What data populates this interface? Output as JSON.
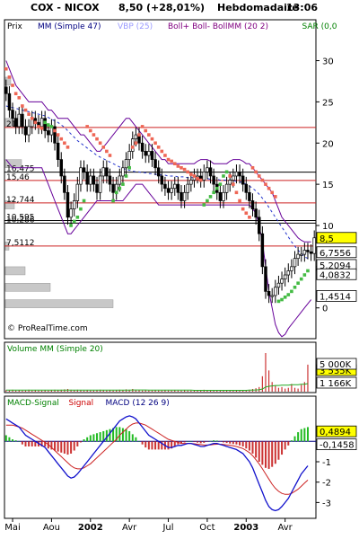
{
  "header": {
    "symbol": "COX - NICOX",
    "quote": "8,50 (+28,01%)",
    "period": "Hebdomadaire",
    "time": "13:06"
  },
  "legend_main": [
    {
      "text": "Prix",
      "color": "#000000"
    },
    {
      "text": "MM (Simple 47)",
      "color": "#000080"
    },
    {
      "text": "VBP (25)",
      "color": "#9a9aff"
    },
    {
      "text": "Boll+ Boll- BollMM (20 2)",
      "color": "#800080"
    },
    {
      "text": "SAR (0,0",
      "color": "#008000"
    }
  ],
  "legend_volume": {
    "text": "Volume MM (Simple 20)",
    "color": "#008000"
  },
  "legend_macd": [
    {
      "text": "MACD-Signal",
      "color": "#008000"
    },
    {
      "text": "Signal",
      "color": "#cc0000"
    },
    {
      "text": "MACD (12 26 9)",
      "color": "#000080"
    }
  ],
  "watermark": "© ProRealTime.com",
  "colors": {
    "frame": "#000000",
    "bg": "#ffffff",
    "candle_up": "#ffffff",
    "candle_down": "#000000",
    "sar_up": "#44bb44",
    "sar_down": "#ee6655",
    "boll": "#660099",
    "mm": "#2233cc",
    "hline_red": "#cc2222",
    "hline_black": "#000000",
    "vbp": "#c8c8c8",
    "volume": "#cc3333",
    "volume_ma": "#22aa22",
    "macd": "#1111cc",
    "signal": "#cc2222",
    "hist": "#22bb22",
    "hist_neg": "#cc3333",
    "tag_yellow": "#ffff00"
  },
  "chart_data": [
    {
      "type": "candlestick",
      "panel": "price",
      "x_labels": [
        "Mai",
        "Aou",
        "2002",
        "Avr",
        "Jul",
        "Oct",
        "2003",
        "Avr"
      ],
      "y_ticks": [
        0,
        5,
        10,
        15,
        20,
        25,
        30
      ],
      "ylim": [
        -3.3,
        33
      ],
      "right_tags": [
        {
          "text": "8,5",
          "value": 8.5,
          "style": "yellow"
        },
        {
          "text": "6,7556",
          "value": 6.7556,
          "style": "box"
        },
        {
          "text": "5,2094",
          "value": 5.2094,
          "style": "box"
        },
        {
          "text": "4,0832",
          "value": 4.0832,
          "style": "box"
        },
        {
          "text": "1,4514",
          "value": 1.4514,
          "style": "box"
        }
      ],
      "horizontal_levels": [
        {
          "text": "21,9",
          "value": 21.9,
          "color": "red"
        },
        {
          "text": "16,475",
          "value": 16.475,
          "color": "black"
        },
        {
          "text": "15,46",
          "value": 15.46,
          "color": "red"
        },
        {
          "text": "12,744",
          "value": 12.744,
          "color": "red"
        },
        {
          "text": "10,595",
          "value": 10.595,
          "color": "black"
        },
        {
          "text": "10,286",
          "value": 10.286,
          "color": "black"
        },
        {
          "text": "7,5112",
          "value": 7.5112,
          "color": "red"
        }
      ],
      "close": [
        26,
        24,
        23,
        22,
        23.5,
        22,
        21,
        22,
        23,
        22.5,
        22,
        23,
        21.5,
        21,
        22,
        20,
        18,
        16,
        14,
        11,
        12,
        13,
        15,
        17,
        16.5,
        15,
        16,
        15,
        14,
        16,
        17,
        16,
        15,
        14,
        15,
        16,
        17,
        18,
        19,
        20.5,
        21,
        20,
        19,
        18.5,
        19,
        18,
        17,
        16,
        15,
        14.5,
        14,
        14.5,
        15,
        14,
        13,
        14,
        15,
        15.5,
        16,
        16,
        15.5,
        16.5,
        17,
        16,
        15,
        14,
        13,
        14,
        15,
        15.5,
        16,
        16.5,
        16,
        15,
        14,
        13,
        12,
        11,
        9,
        5,
        2,
        1.5,
        1.5,
        2.5,
        3,
        3.5,
        4,
        4.5,
        5,
        6,
        6.5,
        6.5,
        7,
        6.8,
        6.6,
        8.5
      ],
      "sar": [
        29,
        28,
        27,
        26,
        25.5,
        24.5,
        24,
        23.5,
        23,
        22.5,
        22,
        21.8,
        22.5,
        22.2,
        22,
        21.5,
        21,
        20.5,
        20,
        19.5,
        10,
        10.5,
        11,
        12,
        13,
        22,
        21.5,
        21,
        20.5,
        20,
        19.5,
        19,
        18.5,
        13,
        14,
        14.5,
        15,
        16,
        17,
        19.5,
        20,
        21,
        22,
        21.5,
        21,
        20.5,
        20,
        19.5,
        19,
        18.5,
        18,
        17.8,
        17.5,
        17.2,
        17,
        16.8,
        16.5,
        16.2,
        16,
        15.7,
        15.5,
        12.5,
        13,
        13.5,
        14,
        14.5,
        15,
        16,
        16.5,
        16,
        15,
        14,
        13,
        12,
        11.5,
        11,
        17,
        16.5,
        16,
        15.5,
        15,
        14.5,
        14,
        13.5,
        0.8,
        1,
        1.3,
        1.6,
        2,
        2.5,
        3,
        3.5,
        4,
        4.5
      ],
      "sar_trend": [
        -1,
        -1,
        -1,
        -1,
        -1,
        -1,
        -1,
        -1,
        -1,
        -1,
        -1,
        -1,
        1,
        1,
        1,
        -1,
        -1,
        -1,
        -1,
        -1,
        1,
        1,
        1,
        1,
        1,
        -1,
        -1,
        -1,
        -1,
        -1,
        -1,
        -1,
        -1,
        1,
        1,
        1,
        1,
        1,
        1,
        -1,
        -1,
        -1,
        -1,
        -1,
        -1,
        -1,
        -1,
        -1,
        -1,
        -1,
        -1,
        -1,
        -1,
        -1,
        -1,
        -1,
        -1,
        -1,
        -1,
        -1,
        -1,
        1,
        1,
        1,
        1,
        1,
        1,
        1,
        1,
        -1,
        -1,
        -1,
        -1,
        -1,
        -1,
        -1,
        -1,
        -1,
        -1,
        -1,
        -1,
        -1,
        -1,
        -1,
        1,
        1,
        1,
        1,
        1,
        1,
        1,
        1,
        1,
        1
      ],
      "boll_upper": [
        30,
        29,
        28,
        27,
        26.5,
        26,
        25.5,
        25,
        25,
        25,
        25,
        25,
        24.5,
        24,
        24,
        23.5,
        23,
        23,
        23,
        23,
        22.5,
        22,
        21.5,
        21,
        21,
        20.5,
        20,
        19.5,
        19,
        19,
        19.5,
        20,
        20.5,
        21,
        21.5,
        22,
        22.5,
        23,
        23,
        22.5,
        22,
        21.5,
        21,
        20.5,
        20,
        19.5,
        19,
        18.5,
        18,
        18,
        17.5,
        17.5,
        17.5,
        17.5,
        17.5,
        17.5,
        17.5,
        17.5,
        17.5,
        17.8,
        18,
        18,
        18,
        17.8,
        17.5,
        17.5,
        17.5,
        17.5,
        17.5,
        17.8,
        18,
        18,
        18,
        17.8,
        17.5,
        17.5,
        17,
        16.5,
        16,
        15.5,
        15,
        14.5,
        14,
        13,
        12,
        11,
        10.5,
        10,
        9.5,
        9,
        8.5,
        8.2,
        8,
        8,
        8
      ],
      "boll_lower": [
        18,
        17.5,
        17,
        17,
        17,
        17,
        17,
        17,
        17,
        17,
        17,
        17,
        16,
        15,
        14,
        13,
        12,
        11,
        10,
        9,
        9,
        9.5,
        10,
        10.5,
        11,
        11.5,
        12,
        12.5,
        13,
        13,
        13,
        13,
        13,
        13,
        13,
        13,
        13,
        13.5,
        14,
        14.5,
        15,
        15,
        15,
        14.5,
        14,
        13.5,
        13,
        12.5,
        12.5,
        12.5,
        12.5,
        12.5,
        12.5,
        12.5,
        12.5,
        12.5,
        12.5,
        12.5,
        12.5,
        12.5,
        12.5,
        12.5,
        12.5,
        12.5,
        12.5,
        12.5,
        12.5,
        12.5,
        12.5,
        12.5,
        12.5,
        12.5,
        12.5,
        12.5,
        12.5,
        12.5,
        12,
        11.5,
        10,
        8,
        5,
        2,
        0,
        -2,
        -3,
        -3.5,
        -3.2,
        -2.5,
        -2,
        -1.5,
        -1,
        -0.5,
        0,
        0.5,
        1
      ],
      "mm47": [
        24.5,
        24.4,
        24.3,
        24.2,
        24.1,
        24,
        23.9,
        23.8,
        23.7,
        23.6,
        23.5,
        23.4,
        23.3,
        23.1,
        22.9,
        22.7,
        22.5,
        22.2,
        21.9,
        21.5,
        21.1,
        20.7,
        20.3,
        20,
        19.7,
        19.4,
        19.1,
        18.8,
        18.5,
        18.3,
        18.1,
        17.9,
        17.7,
        17.5,
        17.3,
        17.1,
        16.9,
        16.8,
        16.7,
        16.6,
        16.5,
        16.5,
        16.4,
        16.4,
        16.3,
        16.3,
        16.2,
        16.2,
        16.1,
        16.1,
        16,
        16,
        16,
        15.9,
        15.9,
        15.9,
        15.8,
        15.8,
        15.8,
        15.8,
        15.7,
        15.7,
        15.7,
        15.6,
        15.6,
        15.6,
        15.5,
        15.5,
        15.5,
        15.5,
        15.4,
        15.4,
        15.3,
        15.2,
        15,
        14.8,
        14.5,
        14.2,
        13.8,
        13.3,
        12.8,
        12.2,
        11.6,
        11,
        10.4,
        9.8,
        9.2,
        8.6,
        8,
        7.5,
        7,
        6.6,
        6.2,
        6
      ],
      "vbp_bins": [
        {
          "price": 27.5,
          "size": 6
        },
        {
          "price": 22.5,
          "size": 20
        },
        {
          "price": 17.5,
          "size": 18
        },
        {
          "price": 12.5,
          "size": 10
        },
        {
          "price": 7.5,
          "size": 4
        },
        {
          "price": 4.5,
          "size": 22
        },
        {
          "price": 2.5,
          "size": 50
        },
        {
          "price": 0.5,
          "size": 120
        }
      ]
    },
    {
      "type": "bar",
      "panel": "volume",
      "right_tags": [
        {
          "text": "3 535K",
          "style": "yellow"
        },
        {
          "text": "5 000K",
          "style": "box"
        },
        {
          "text": "1 166K",
          "style": "box"
        }
      ],
      "values": [
        0.04,
        0.03,
        0.05,
        0.03,
        0.04,
        0.03,
        0.03,
        0.05,
        0.03,
        0.04,
        0.03,
        0.03,
        0.04,
        0.03,
        0.04,
        0.05,
        0.04,
        0.05,
        0.06,
        0.07,
        0.05,
        0.04,
        0.05,
        0.04,
        0.03,
        0.04,
        0.03,
        0.03,
        0.04,
        0.05,
        0.04,
        0.03,
        0.04,
        0.03,
        0.04,
        0.05,
        0.04,
        0.06,
        0.05,
        0.07,
        0.05,
        0.04,
        0.03,
        0.04,
        0.03,
        0.03,
        0.04,
        0.03,
        0.03,
        0.04,
        0.03,
        0.03,
        0.04,
        0.03,
        0.03,
        0.04,
        0.03,
        0.03,
        0.04,
        0.03,
        0.04,
        0.05,
        0.04,
        0.03,
        0.03,
        0.04,
        0.03,
        0.03,
        0.04,
        0.03,
        0.04,
        0.03,
        0.03,
        0.04,
        0.03,
        0.05,
        0.07,
        0.09,
        0.12,
        0.4,
        1.0,
        0.55,
        0.25,
        0.15,
        0.1,
        0.12,
        0.08,
        0.1,
        0.2,
        0.1,
        0.08,
        0.18,
        0.25,
        0.7
      ],
      "ma20": [
        0.04,
        0.04,
        0.04,
        0.04,
        0.04,
        0.04,
        0.04,
        0.04,
        0.04,
        0.04,
        0.04,
        0.04,
        0.04,
        0.04,
        0.04,
        0.04,
        0.04,
        0.04,
        0.04,
        0.04,
        0.04,
        0.04,
        0.04,
        0.04,
        0.04,
        0.04,
        0.04,
        0.04,
        0.04,
        0.04,
        0.04,
        0.04,
        0.04,
        0.04,
        0.04,
        0.04,
        0.04,
        0.04,
        0.04,
        0.045,
        0.045,
        0.045,
        0.045,
        0.045,
        0.04,
        0.04,
        0.04,
        0.04,
        0.04,
        0.04,
        0.04,
        0.04,
        0.04,
        0.04,
        0.04,
        0.04,
        0.04,
        0.04,
        0.035,
        0.035,
        0.035,
        0.035,
        0.035,
        0.035,
        0.035,
        0.035,
        0.035,
        0.035,
        0.035,
        0.035,
        0.035,
        0.035,
        0.035,
        0.035,
        0.035,
        0.04,
        0.04,
        0.045,
        0.05,
        0.07,
        0.12,
        0.14,
        0.15,
        0.16,
        0.16,
        0.17,
        0.17,
        0.17,
        0.18,
        0.18,
        0.18,
        0.19,
        0.19,
        0.21
      ]
    },
    {
      "type": "line",
      "panel": "macd",
      "y_ticks": [
        -3,
        -2,
        -1
      ],
      "ylim": [
        -3.6,
        1.6
      ],
      "right_tags": [
        {
          "text": "0,4894",
          "value": 0.4894,
          "style": "yellow"
        },
        {
          "text": "-0,1458",
          "value": -0.1458,
          "style": "box"
        }
      ],
      "macd": [
        1.1,
        1.0,
        0.9,
        0.8,
        0.7,
        0.5,
        0.3,
        0.2,
        0.1,
        0,
        -0.1,
        -0.2,
        -0.3,
        -0.5,
        -0.7,
        -0.9,
        -1.1,
        -1.3,
        -1.5,
        -1.7,
        -1.8,
        -1.75,
        -1.6,
        -1.4,
        -1.2,
        -1,
        -0.8,
        -0.6,
        -0.4,
        -0.2,
        0,
        0.2,
        0.4,
        0.6,
        0.8,
        1,
        1.1,
        1.2,
        1.25,
        1.2,
        1.1,
        0.9,
        0.7,
        0.5,
        0.3,
        0.2,
        0.1,
        0,
        -0.1,
        -0.2,
        -0.3,
        -0.3,
        -0.25,
        -0.2,
        -0.2,
        -0.15,
        -0.1,
        -0.1,
        -0.15,
        -0.2,
        -0.25,
        -0.25,
        -0.2,
        -0.15,
        -0.1,
        -0.1,
        -0.15,
        -0.2,
        -0.25,
        -0.3,
        -0.35,
        -0.4,
        -0.5,
        -0.6,
        -0.8,
        -1,
        -1.3,
        -1.7,
        -2.1,
        -2.5,
        -2.9,
        -3.2,
        -3.35,
        -3.4,
        -3.35,
        -3.2,
        -3,
        -2.8,
        -2.5,
        -2.2,
        -1.9,
        -1.6,
        -1.4,
        -1.2
      ],
      "signal": [
        0.8,
        0.8,
        0.8,
        0.75,
        0.7,
        0.65,
        0.55,
        0.45,
        0.35,
        0.25,
        0.15,
        0.05,
        -0.05,
        -0.15,
        -0.3,
        -0.45,
        -0.6,
        -0.75,
        -0.9,
        -1.05,
        -1.2,
        -1.3,
        -1.35,
        -1.35,
        -1.3,
        -1.2,
        -1.1,
        -0.95,
        -0.8,
        -0.65,
        -0.5,
        -0.35,
        -0.2,
        -0.05,
        0.1,
        0.3,
        0.45,
        0.6,
        0.75,
        0.85,
        0.9,
        0.9,
        0.85,
        0.8,
        0.7,
        0.6,
        0.5,
        0.4,
        0.3,
        0.2,
        0.1,
        0.05,
        0,
        -0.05,
        -0.1,
        -0.1,
        -0.1,
        -0.1,
        -0.12,
        -0.14,
        -0.16,
        -0.18,
        -0.18,
        -0.17,
        -0.15,
        -0.14,
        -0.14,
        -0.15,
        -0.17,
        -0.19,
        -0.22,
        -0.25,
        -0.3,
        -0.35,
        -0.45,
        -0.55,
        -0.7,
        -0.9,
        -1.1,
        -1.35,
        -1.6,
        -1.85,
        -2.1,
        -2.3,
        -2.45,
        -2.55,
        -2.6,
        -2.6,
        -2.55,
        -2.45,
        -2.35,
        -2.2,
        -2.05,
        -1.9
      ],
      "hist": [
        0.3,
        0.2,
        0.1,
        0.05,
        0,
        -0.15,
        -0.25,
        -0.25,
        -0.25,
        -0.25,
        -0.25,
        -0.25,
        -0.25,
        -0.35,
        -0.4,
        -0.45,
        -0.5,
        -0.55,
        -0.6,
        -0.65,
        -0.6,
        -0.45,
        -0.25,
        -0.05,
        0.1,
        0.2,
        0.3,
        0.35,
        0.4,
        0.45,
        0.5,
        0.55,
        0.6,
        0.65,
        0.7,
        0.7,
        0.65,
        0.6,
        0.5,
        0.35,
        0.2,
        0,
        -0.15,
        -0.3,
        -0.4,
        -0.4,
        -0.4,
        -0.4,
        -0.4,
        -0.4,
        -0.4,
        -0.35,
        -0.25,
        -0.15,
        -0.1,
        -0.05,
        0,
        0,
        -0.03,
        -0.06,
        -0.09,
        -0.07,
        -0.02,
        0.02,
        0.05,
        0.04,
        -0.01,
        -0.05,
        -0.08,
        -0.11,
        -0.13,
        -0.15,
        -0.2,
        -0.25,
        -0.35,
        -0.45,
        -0.6,
        -0.8,
        -1,
        -1.15,
        -1.3,
        -1.35,
        -1.25,
        -1.1,
        -0.9,
        -0.65,
        -0.4,
        -0.2,
        0.05,
        0.25,
        0.45,
        0.6,
        0.65,
        0.7
      ]
    }
  ]
}
